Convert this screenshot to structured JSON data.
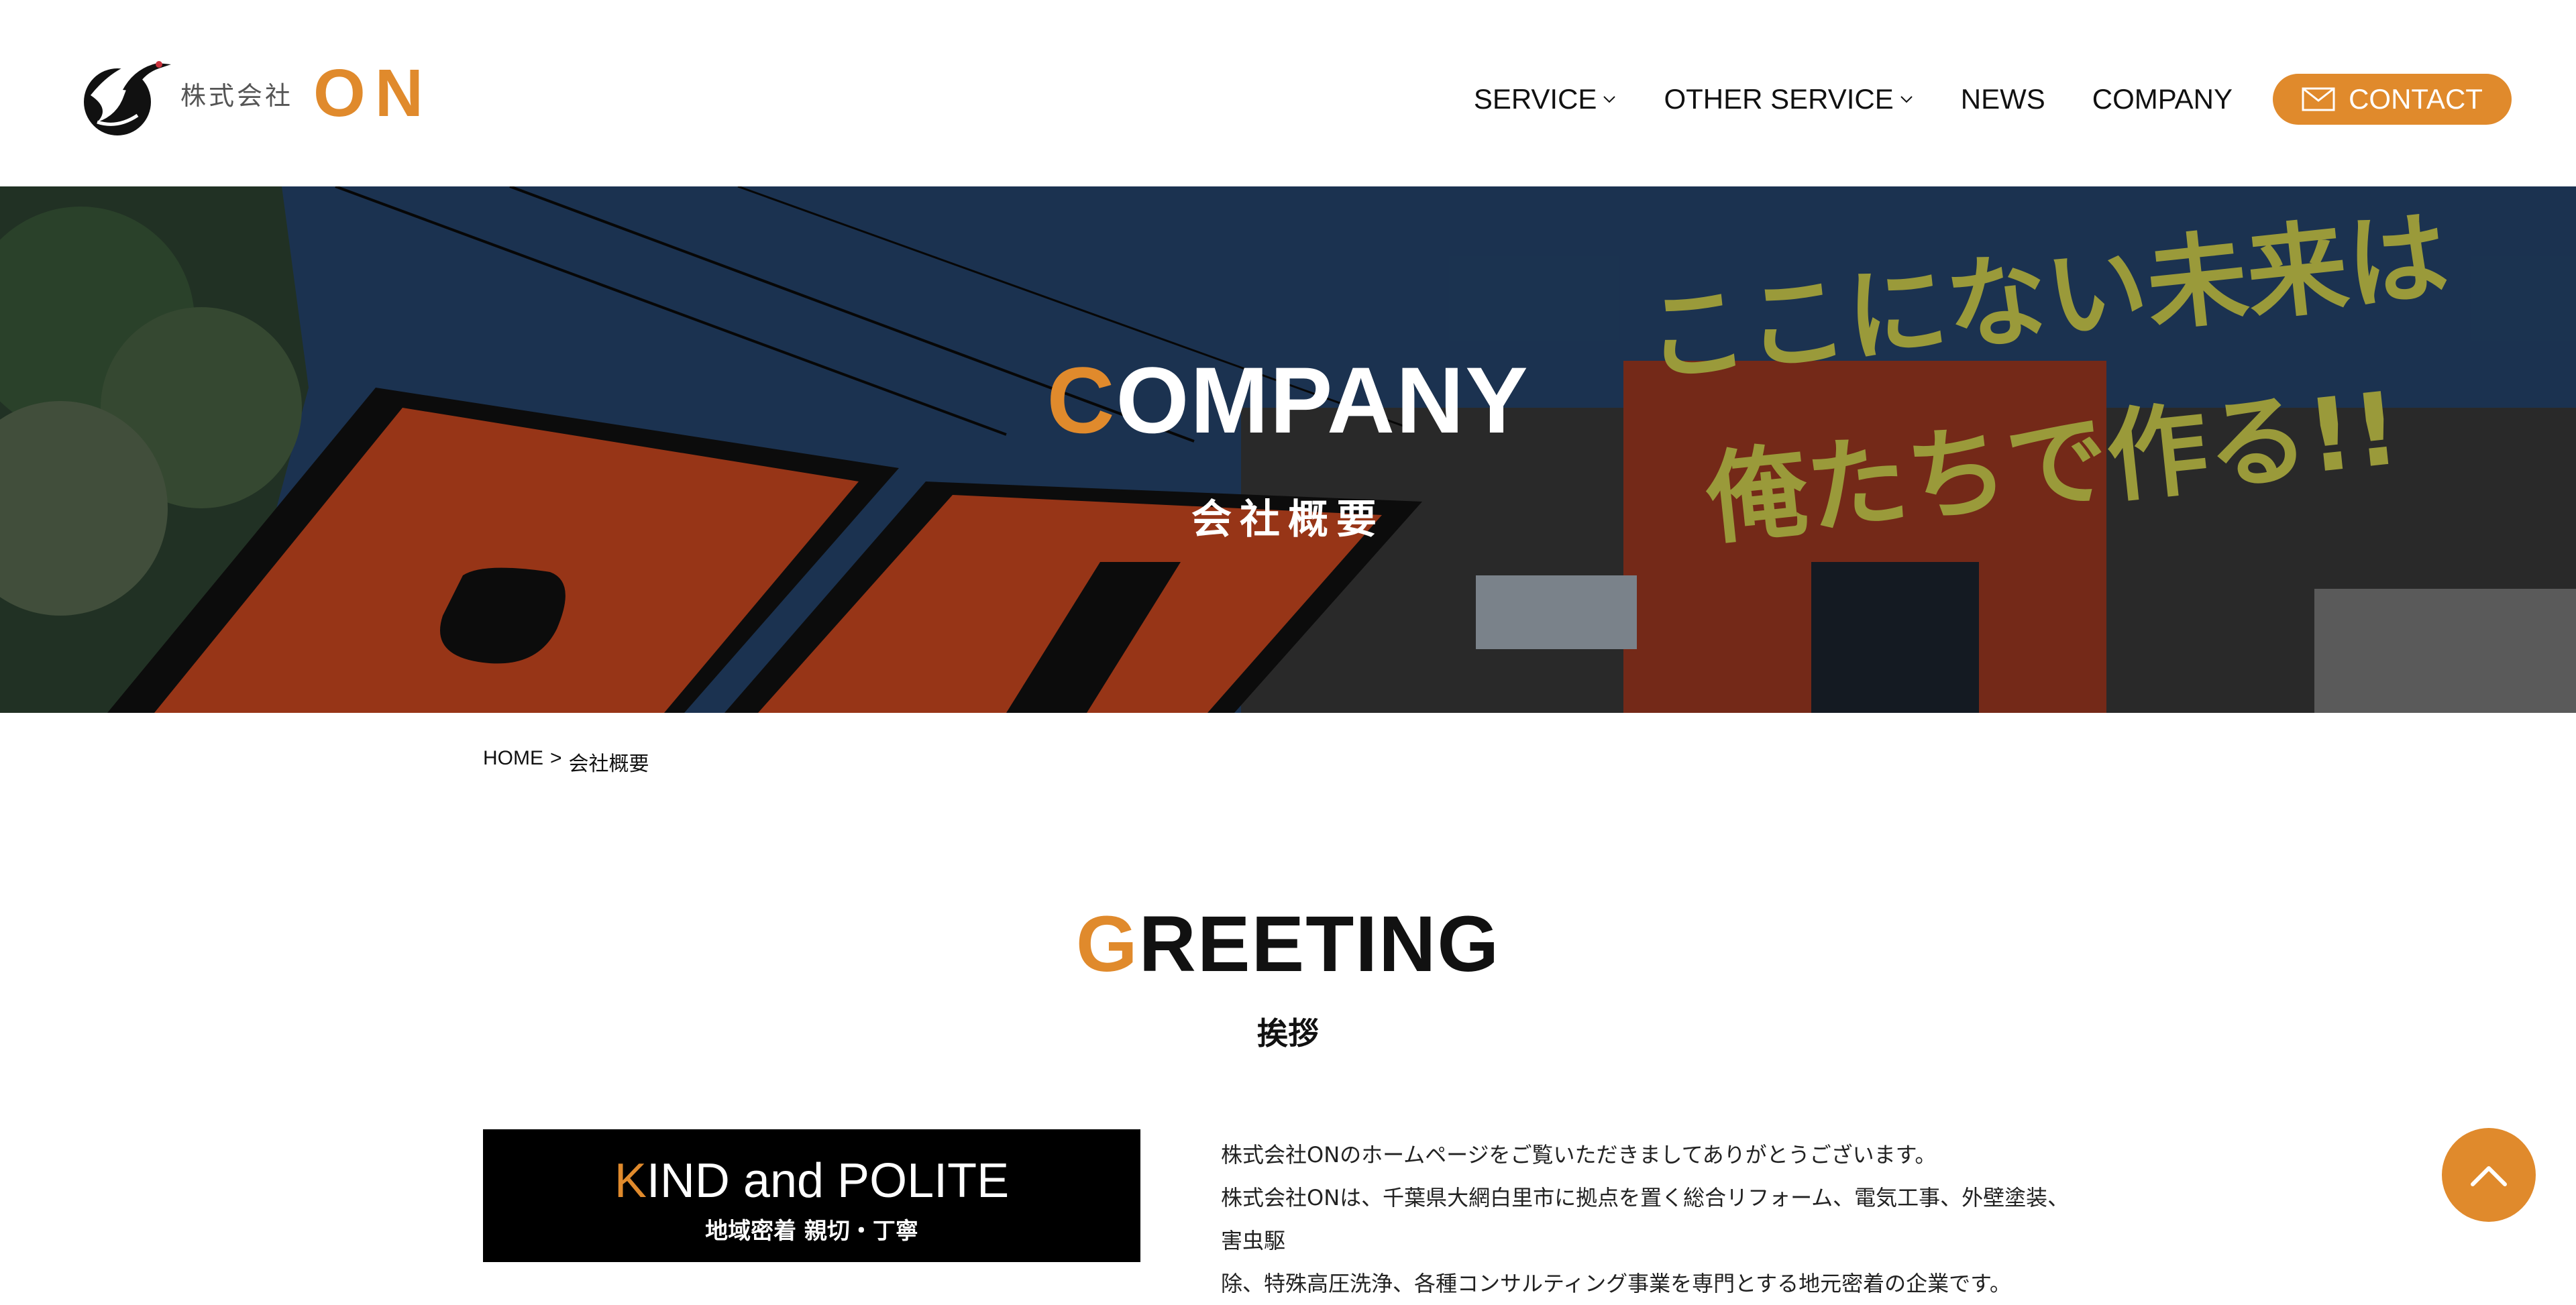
{
  "header": {
    "logo": {
      "company_prefix": "株式会社",
      "brand": "ON"
    },
    "nav": [
      {
        "label": "SERVICE",
        "has_dropdown": true
      },
      {
        "label": "OTHER SERVICE",
        "has_dropdown": true
      },
      {
        "label": "NEWS",
        "has_dropdown": false
      },
      {
        "label": "COMPANY",
        "has_dropdown": false
      }
    ],
    "contact_label": "CONTACT"
  },
  "hero": {
    "title_accent": "C",
    "title_rest": "OMPANY",
    "subtitle": "会社概要",
    "slogan_line1": "ここにない未来は",
    "slogan_line2": "俺たちで作る!!"
  },
  "breadcrumb": {
    "home": "HOME",
    "separator": ">",
    "current": "会社概要"
  },
  "greeting": {
    "title_accent": "G",
    "title_rest": "REETING",
    "subtitle": "挨拶",
    "box_title_accent": "K",
    "box_title_rest": "IND and POLITE",
    "box_subtitle": "地域密着 親切・丁寧",
    "paragraph_lines": [
      "株式会社ONのホームページをご覧いただきましてありがとうございます。",
      "株式会社ONは、千葉県大網白里市に拠点を置く総合リフォーム、電気工事、外壁塗装、害虫駆",
      "除、特殊高圧洗浄、各種コンサルティング事業を専門とする地元密着の企業です。"
    ]
  },
  "colors": {
    "accent": "#e08a2c",
    "text": "#111111",
    "box_bg": "#000000"
  },
  "icons": [
    "crane-logo-icon",
    "chevron-down-icon",
    "mail-icon",
    "chevron-up-icon"
  ]
}
